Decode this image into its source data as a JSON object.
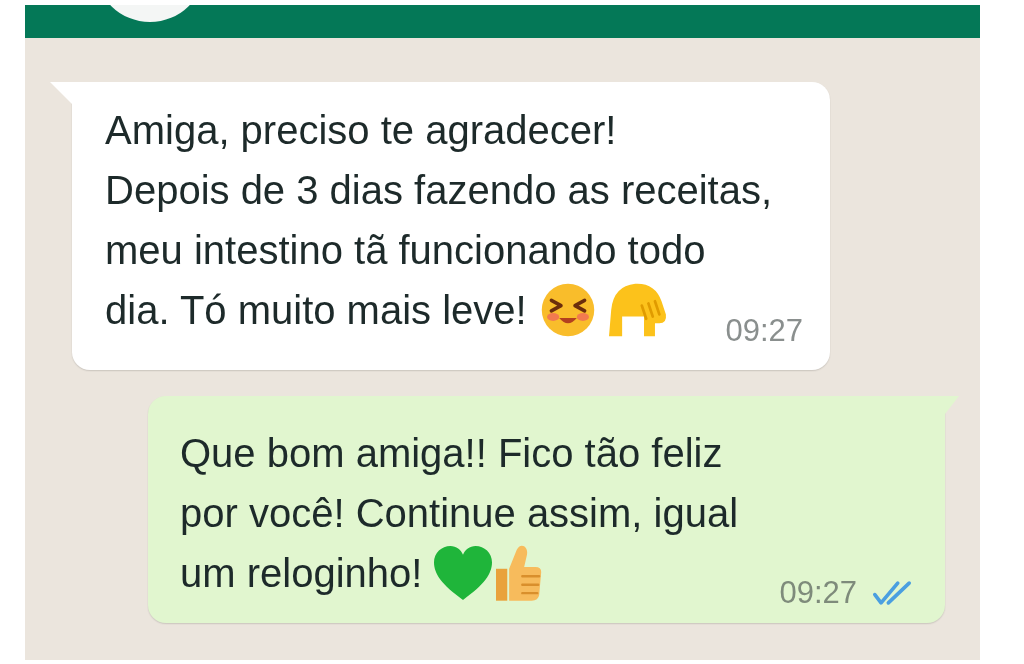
{
  "messages": [
    {
      "kind": "incoming",
      "lines": [
        "Amiga, preciso te agradecer!",
        "Depois de 3 dias fazendo as receitas,",
        "meu intestino tã funcionando todo",
        "dia. Tó muito mais leve!"
      ],
      "emojis": [
        {
          "kind": "smiling-face"
        },
        {
          "kind": "hand"
        }
      ],
      "time": "09:27"
    },
    {
      "kind": "outgoing",
      "lines": [
        "Que bom amiga!! Fico tão feliz",
        "por você! Continue assim, igual",
        "um reloginho!"
      ],
      "emojis": [
        {
          "kind": "green-heart"
        },
        {
          "kind": "thumbs-up"
        }
      ],
      "time": "09:27",
      "read": true
    }
  ]
}
